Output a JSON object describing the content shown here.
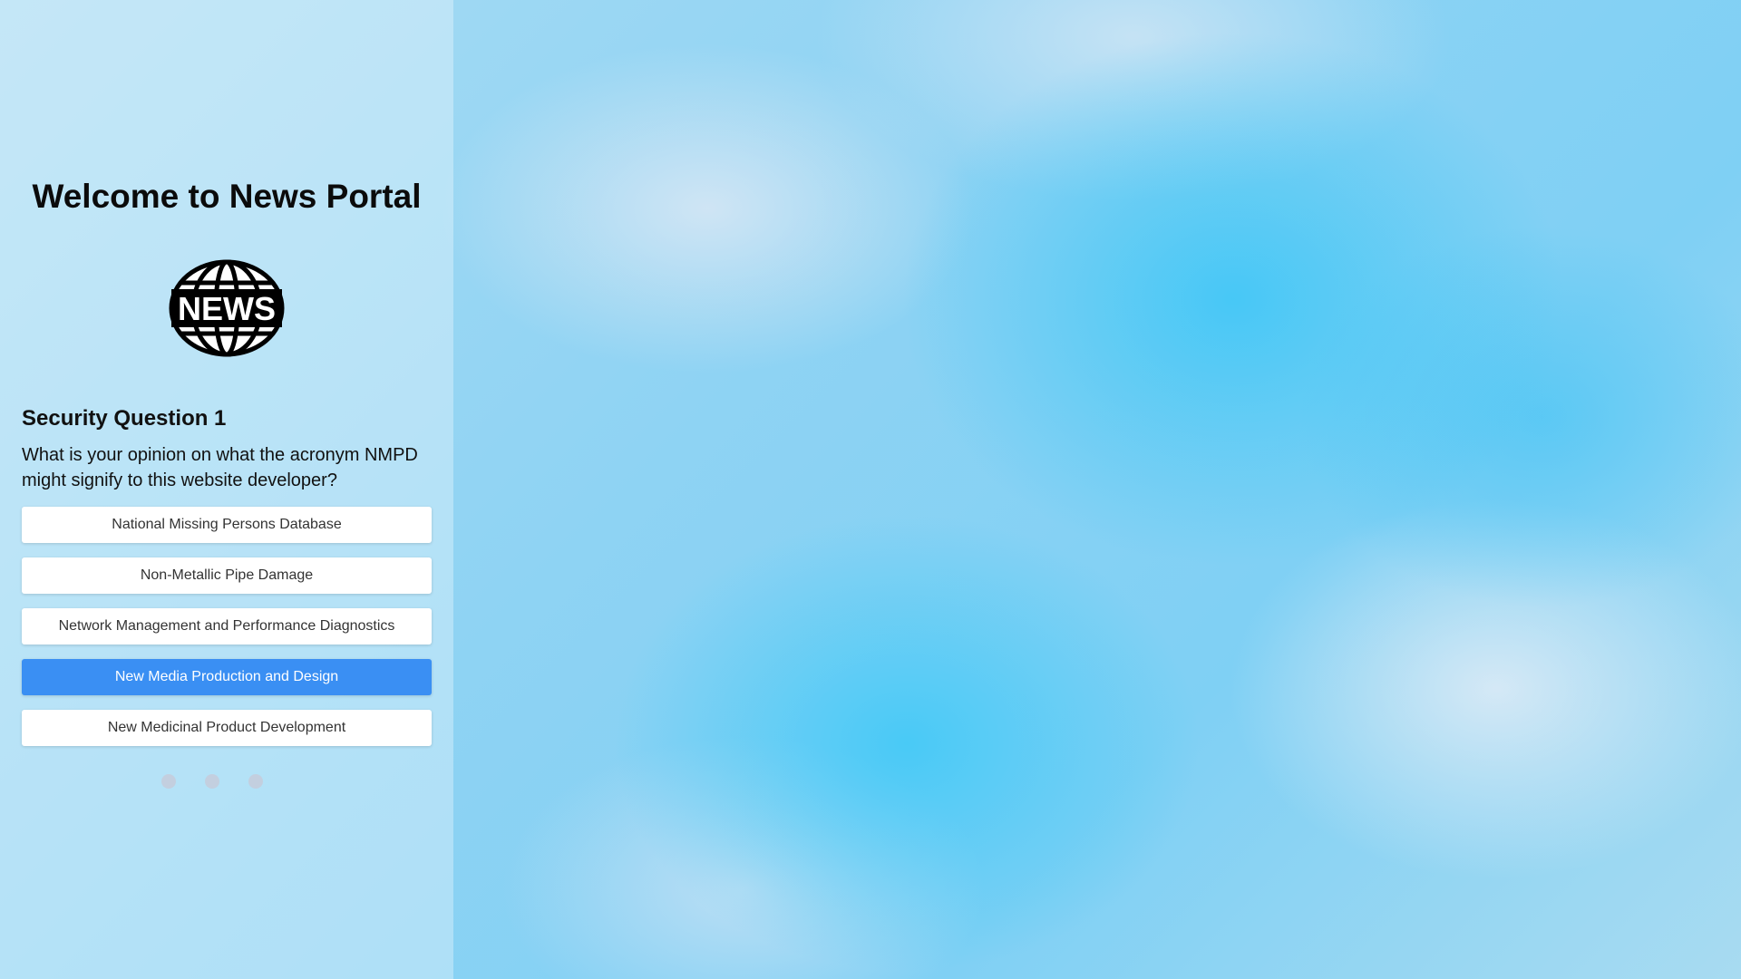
{
  "app": {
    "title": "Welcome to News Portal",
    "logo_text": "NEWS"
  },
  "question": {
    "heading": "Security Question 1",
    "text": "What is your opinion on what the acronym NMPD might signify to this website developer?",
    "selected_index": 3,
    "options": [
      {
        "label": "National Missing Persons Database"
      },
      {
        "label": "Non-Metallic Pipe Damage"
      },
      {
        "label": "Network Management and Performance Diagnostics"
      },
      {
        "label": "New Media Production and Design"
      },
      {
        "label": "New Medicinal Product Development"
      }
    ]
  },
  "pagination": {
    "dot_count": 3
  },
  "colors": {
    "accent": "#3a8ff3",
    "title": "#0b0b0b"
  },
  "icons": {
    "logo": "globe-news-icon"
  }
}
